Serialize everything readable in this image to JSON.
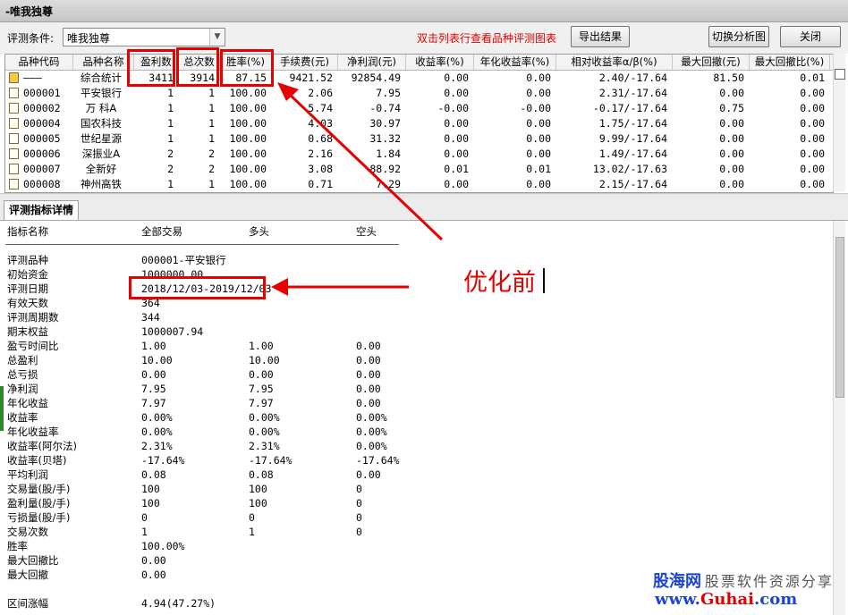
{
  "window": {
    "title": "-唯我独尊"
  },
  "toolbar": {
    "condition_label": "评测条件:",
    "condition_value": "唯我独尊",
    "hint": "双击列表行查看品种评测图表",
    "export_button": "导出结果",
    "switch_button": "切换分析图",
    "close_button": "关闭"
  },
  "grid": {
    "headers": [
      "品种代码",
      "品种名称",
      "盈利数",
      "总次数",
      "胜率(%)",
      "手续费(元)",
      "净利润(元)",
      "收益率(%)",
      "年化收益率(%)",
      "相对收益率α/β(%)",
      "最大回撤(元)",
      "最大回撤比(%)"
    ],
    "rows": [
      [
        "———",
        "综合统计",
        "3411",
        "3914",
        "87.15",
        "9421.52",
        "92854.49",
        "0.00",
        "0.00",
        "2.40/-17.64",
        "81.50",
        "0.01"
      ],
      [
        "000001",
        "平安银行",
        "1",
        "1",
        "100.00",
        "2.06",
        "7.95",
        "0.00",
        "0.00",
        "2.31/-17.64",
        "0.00",
        "0.00"
      ],
      [
        "000002",
        "万 科A",
        "1",
        "1",
        "100.00",
        "5.74",
        "-0.74",
        "-0.00",
        "-0.00",
        "-0.17/-17.64",
        "0.75",
        "0.00"
      ],
      [
        "000004",
        "国农科技",
        "1",
        "1",
        "100.00",
        "4.03",
        "30.97",
        "0.00",
        "0.00",
        "1.75/-17.64",
        "0.00",
        "0.00"
      ],
      [
        "000005",
        "世纪星源",
        "1",
        "1",
        "100.00",
        "0.68",
        "31.32",
        "0.00",
        "0.00",
        "9.99/-17.64",
        "0.00",
        "0.00"
      ],
      [
        "000006",
        "深振业A",
        "2",
        "2",
        "100.00",
        "2.16",
        "1.84",
        "0.00",
        "0.00",
        "1.49/-17.64",
        "0.00",
        "0.00"
      ],
      [
        "000007",
        "全新好",
        "2",
        "2",
        "100.00",
        "3.08",
        "88.92",
        "0.01",
        "0.01",
        "13.02/-17.63",
        "0.00",
        "0.00"
      ],
      [
        "000008",
        "神州高铁",
        "1",
        "1",
        "100.00",
        "0.71",
        "7.29",
        "0.00",
        "0.00",
        "2.15/-17.64",
        "0.00",
        "0.00"
      ]
    ]
  },
  "detail": {
    "tab": "评测指标详情",
    "headers": [
      "指标名称",
      "全部交易",
      "多头",
      "空头"
    ],
    "rows": [
      [
        "评测品种",
        "000001-平安银行",
        "",
        ""
      ],
      [
        "初始资金",
        "1000000.00",
        "",
        ""
      ],
      [
        "评测日期",
        "2018/12/03-2019/12/03",
        "",
        ""
      ],
      [
        "有效天数",
        "364",
        "",
        ""
      ],
      [
        "评测周期数",
        "344",
        "",
        ""
      ],
      [
        "期末权益",
        "1000007.94",
        "",
        ""
      ],
      [
        "盈亏时间比",
        "1.00",
        "1.00",
        "0.00"
      ],
      [
        "总盈利",
        "10.00",
        "10.00",
        "0.00"
      ],
      [
        "总亏损",
        "0.00",
        "0.00",
        "0.00"
      ],
      [
        "净利润",
        "7.95",
        "7.95",
        "0.00"
      ],
      [
        "年化收益",
        "7.97",
        "7.97",
        "0.00"
      ],
      [
        "收益率",
        "0.00%",
        "0.00%",
        "0.00%"
      ],
      [
        "年化收益率",
        "0.00%",
        "0.00%",
        "0.00%"
      ],
      [
        "收益率(阿尔法)",
        "2.31%",
        "2.31%",
        "0.00%"
      ],
      [
        "收益率(贝塔)",
        "-17.64%",
        "-17.64%",
        "-17.64%"
      ],
      [
        "平均利润",
        "0.08",
        "0.08",
        "0.00"
      ],
      [
        "交易量(股/手)",
        "100",
        "100",
        "0"
      ],
      [
        "盈利量(股/手)",
        "100",
        "100",
        "0"
      ],
      [
        "亏损量(股/手)",
        "0",
        "0",
        "0"
      ],
      [
        "交易次数",
        "1",
        "1",
        "0"
      ],
      [
        "胜率",
        "100.00%",
        "",
        ""
      ],
      [
        "最大回撤比",
        "0.00",
        "",
        ""
      ],
      [
        "最大回撤",
        "0.00",
        "",
        ""
      ]
    ],
    "last_row": [
      "区间涨幅",
      "4.94(47.27%)"
    ]
  },
  "annotation": {
    "text": "优化前"
  },
  "watermark": {
    "brand": "股海网",
    "tagline": "股票软件资源分享",
    "site_prefix": "www.",
    "site_name": "Guhai",
    "site_suffix": ".com"
  }
}
